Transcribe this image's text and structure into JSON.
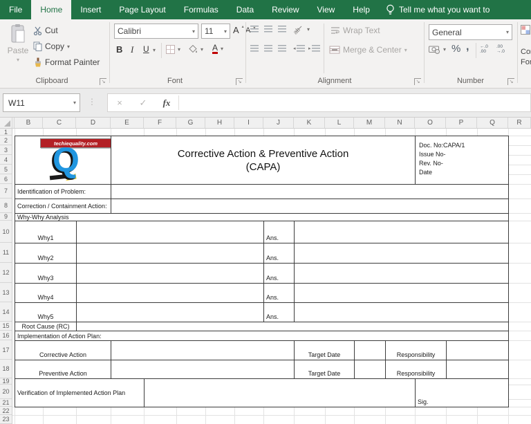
{
  "menu": {
    "tabs": [
      {
        "label": "File"
      },
      {
        "label": "Home",
        "active": true
      },
      {
        "label": "Insert"
      },
      {
        "label": "Page Layout"
      },
      {
        "label": "Formulas"
      },
      {
        "label": "Data"
      },
      {
        "label": "Review"
      },
      {
        "label": "View"
      },
      {
        "label": "Help"
      }
    ],
    "tell_me": "Tell me what you want to"
  },
  "ribbon": {
    "clipboard": {
      "label": "Clipboard",
      "paste": "Paste",
      "cut": "Cut",
      "copy": "Copy",
      "format_painter": "Format Painter"
    },
    "font": {
      "label": "Font",
      "family": "Calibri",
      "size": "11",
      "bold": "B",
      "italic": "I",
      "underline": "U",
      "grow": "A",
      "shrink": "A",
      "color_letter": "A"
    },
    "alignment": {
      "label": "Alignment",
      "wrap_text": "Wrap Text",
      "merge_center": "Merge & Center",
      "orientation_ab": "ab"
    },
    "number": {
      "label": "Number",
      "format": "General",
      "percent": "%",
      "comma": ",",
      "increase_decimal": [
        "←.0",
        ".00"
      ],
      "decrease_decimal": [
        ".00",
        "→.0"
      ]
    },
    "conditional": {
      "line1": "Cond",
      "line2": "Form"
    }
  },
  "formula_bar": {
    "name_box": "W11",
    "value": ""
  },
  "grid": {
    "columns": [
      "B",
      "C",
      "D",
      "E",
      "F",
      "G",
      "H",
      "I",
      "J",
      "K",
      "L",
      "M",
      "N",
      "O",
      "P",
      "Q",
      "R"
    ],
    "rows": [
      "1",
      "2",
      "3",
      "4",
      "5",
      "6",
      "7",
      "8",
      "9",
      "10",
      "11",
      "12",
      "13",
      "14",
      "15",
      "16",
      "17",
      "18",
      "19",
      "20",
      "21",
      "22",
      "23"
    ]
  },
  "form": {
    "logo": {
      "banner": "techiequality.com",
      "letter": "Q"
    },
    "title_line1": "Corrective Action & Preventive Action",
    "title_line2": "(CAPA)",
    "doc_lines": [
      "Doc. No:CAPA/1",
      "Issue No-",
      "Rev. No-",
      "Date"
    ],
    "identification": "Identification of Problem:",
    "correction": "Correction / Containment Action:",
    "why_why": "Why-Why Analysis",
    "whys": [
      {
        "label": "Why1",
        "ans": "Ans."
      },
      {
        "label": "Why2",
        "ans": "Ans."
      },
      {
        "label": "Why3",
        "ans": "Ans."
      },
      {
        "label": "Why4",
        "ans": "Ans."
      },
      {
        "label": "Why5",
        "ans": "Ans."
      }
    ],
    "root_cause": "Root Cause (RC)",
    "implementation": "Implementation of Action Plan:",
    "action_rows": [
      {
        "label": "Corrective Action",
        "target": "Target Date",
        "resp": "Responsibility"
      },
      {
        "label": "Preventive Action",
        "target": "Target Date",
        "resp": "Responsibility"
      }
    ],
    "verification": "Verification of Implemented Action Plan",
    "sig": "Sig."
  },
  "icons": {
    "dropdown": "▾",
    "up_caret": "▴",
    "dots": "⋮",
    "cancel": "×",
    "enter": "✓",
    "fx": "fx",
    "arrow_se": "↘",
    "indent_left": "◂",
    "indent_right": "▸"
  },
  "colors": {
    "excel_green": "#217346",
    "form_border": "#3b3b3b",
    "banner_red": "#b32025",
    "q_blue": "#2196e0"
  }
}
